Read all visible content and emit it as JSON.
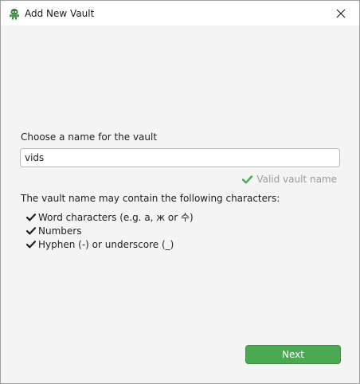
{
  "window": {
    "title": "Add New Vault",
    "app_icon": "cryptomator-robot-icon",
    "close_icon": "close-icon"
  },
  "form": {
    "name_label": "Choose a name for the vault",
    "name_value": "vids",
    "validation_text": "Valid vault name",
    "validation_icon": "checkmark-icon",
    "chars_intro": "The vault name may contain the following characters:",
    "rules": [
      "Word characters (e.g. a, ж or 수)",
      "Numbers",
      "Hyphen (-) or underscore (_)"
    ],
    "next_label": "Next"
  },
  "colors": {
    "accent_green": "#4ba953",
    "valid_check": "#4ba953",
    "muted_text": "#9a9a9a"
  }
}
